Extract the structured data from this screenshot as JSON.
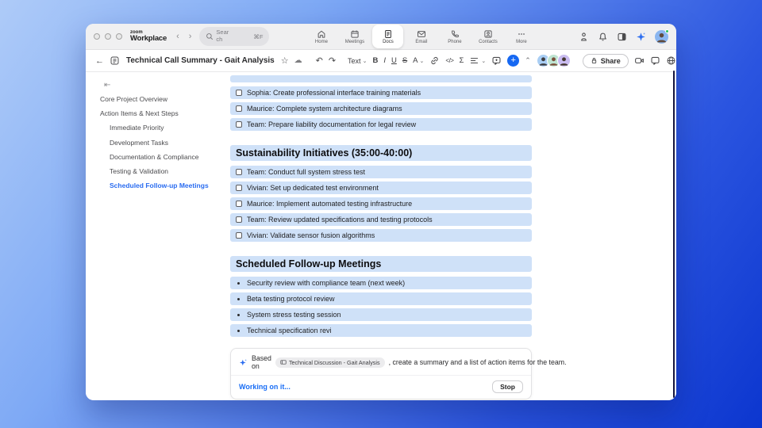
{
  "topbar": {
    "logo": {
      "line1": "zoom",
      "line2": "Workplace"
    },
    "search": {
      "placeholder": "Search",
      "shortcut": "⌘F"
    },
    "tabs": [
      {
        "label": "Home",
        "icon": "home-icon",
        "active": false
      },
      {
        "label": "Meetings",
        "icon": "calendar-icon",
        "active": false
      },
      {
        "label": "Docs",
        "icon": "doc-icon",
        "active": true
      },
      {
        "label": "Email",
        "icon": "mail-icon",
        "active": false
      },
      {
        "label": "Phone",
        "icon": "phone-icon",
        "active": false
      },
      {
        "label": "Contacts",
        "icon": "contacts-icon",
        "active": false
      },
      {
        "label": "More",
        "icon": "more-icon",
        "active": false
      }
    ]
  },
  "doc_toolbar": {
    "title": "Technical Call Summary - Gait Analysis",
    "undo_glyph": "↶",
    "redo_glyph": "↷",
    "text_menu_label": "Text",
    "bold_label": "B",
    "italic_label": "I",
    "underline_label": "U",
    "strike_label": "S",
    "color_label": "A",
    "code_label": "</>",
    "formula_label": "Σ",
    "share_label": "Share",
    "star_glyph": "☆",
    "cloud_glyph": "☁",
    "more_glyph": "⋯",
    "collapse_chevron": "⌃"
  },
  "sidebar": {
    "collapse_glyph": "⇤",
    "items": [
      {
        "label": "Core Project Overview",
        "level": 0,
        "active": false
      },
      {
        "label": "Action Items & Next Steps",
        "level": 0,
        "active": false
      },
      {
        "label": "Immediate Priority",
        "level": 1,
        "active": false
      },
      {
        "label": "Development Tasks",
        "level": 1,
        "active": false
      },
      {
        "label": "Documentation & Compliance",
        "level": 1,
        "active": false
      },
      {
        "label": "Testing & Validation",
        "level": 1,
        "active": false
      },
      {
        "label": "Scheduled Follow-up Meetings",
        "level": 1,
        "active": true
      }
    ]
  },
  "document": {
    "sections": [
      {
        "type": "checklist",
        "items": [
          "Sophia: Create professional interface training materials",
          "Maurice: Complete system architecture diagrams",
          "Team: Prepare liability documentation for legal review"
        ]
      },
      {
        "type": "heading",
        "text": "Sustainability Initiatives (35:00-40:00)"
      },
      {
        "type": "checklist",
        "items": [
          "Team: Conduct full system stress test",
          "Vivian: Set up dedicated test environment",
          "Maurice: Implement automated testing infrastructure",
          "Team: Review updated specifications and testing protocols",
          "Vivian: Validate sensor fusion algorithms"
        ]
      },
      {
        "type": "heading",
        "text": "Scheduled Follow-up Meetings"
      },
      {
        "type": "bullets",
        "items": [
          "Security review with compliance team (next week)",
          "Beta testing protocol review",
          "System stress testing session",
          "Technical specification revi"
        ]
      }
    ]
  },
  "ai_panel": {
    "prefix": "Based on",
    "chip_label": "Technical Discussion - Gait Analysis",
    "suffix": ", create a summary and a list of action items for the team.",
    "status": "Working on it...",
    "stop_label": "Stop"
  },
  "colors": {
    "accent_blue": "#1668f2",
    "row_highlight": "#cfe1f8",
    "active_link": "#2a6cf0",
    "background_top": "#aecbf8",
    "background_bottom": "#0c36cf",
    "presence_green": "#29c15d"
  }
}
